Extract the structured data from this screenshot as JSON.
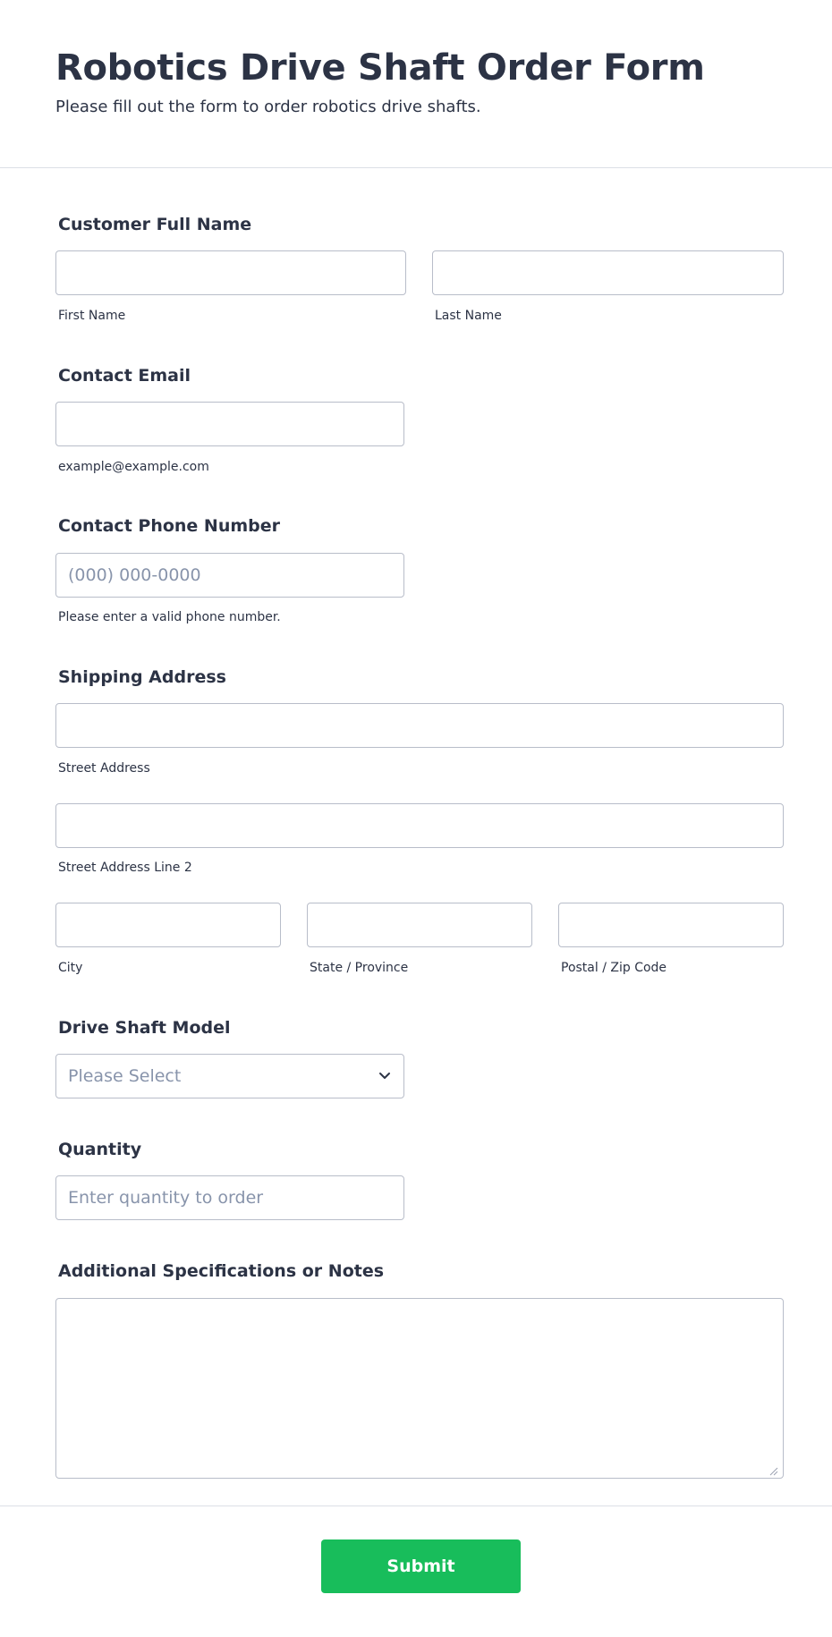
{
  "header": {
    "title": "Robotics Drive Shaft Order Form",
    "subtitle": "Please fill out the form to order robotics drive shafts."
  },
  "fields": {
    "full_name": {
      "label": "Customer Full Name",
      "first_sublabel": "First Name",
      "last_sublabel": "Last Name",
      "first_value": "",
      "last_value": ""
    },
    "email": {
      "label": "Contact Email",
      "sublabel": "example@example.com",
      "value": ""
    },
    "phone": {
      "label": "Contact Phone Number",
      "placeholder": "(000) 000-0000",
      "sublabel": "Please enter a valid phone number.",
      "value": ""
    },
    "address": {
      "label": "Shipping Address",
      "street_sublabel": "Street Address",
      "street2_sublabel": "Street Address Line 2",
      "city_sublabel": "City",
      "state_sublabel": "State / Province",
      "zip_sublabel": "Postal / Zip Code"
    },
    "model": {
      "label": "Drive Shaft Model",
      "selected": "Please Select",
      "icon": "chevron-down-icon"
    },
    "quantity": {
      "label": "Quantity",
      "placeholder": "Enter quantity to order",
      "value": ""
    },
    "notes": {
      "label": "Additional Specifications or Notes",
      "value": ""
    }
  },
  "submit": {
    "label": "Submit"
  },
  "colors": {
    "text": "#2c3345",
    "border": "#b8bdc9",
    "placeholder": "#8894ab",
    "submit_bg": "#18bd5b",
    "divider": "#dcdfe6"
  }
}
